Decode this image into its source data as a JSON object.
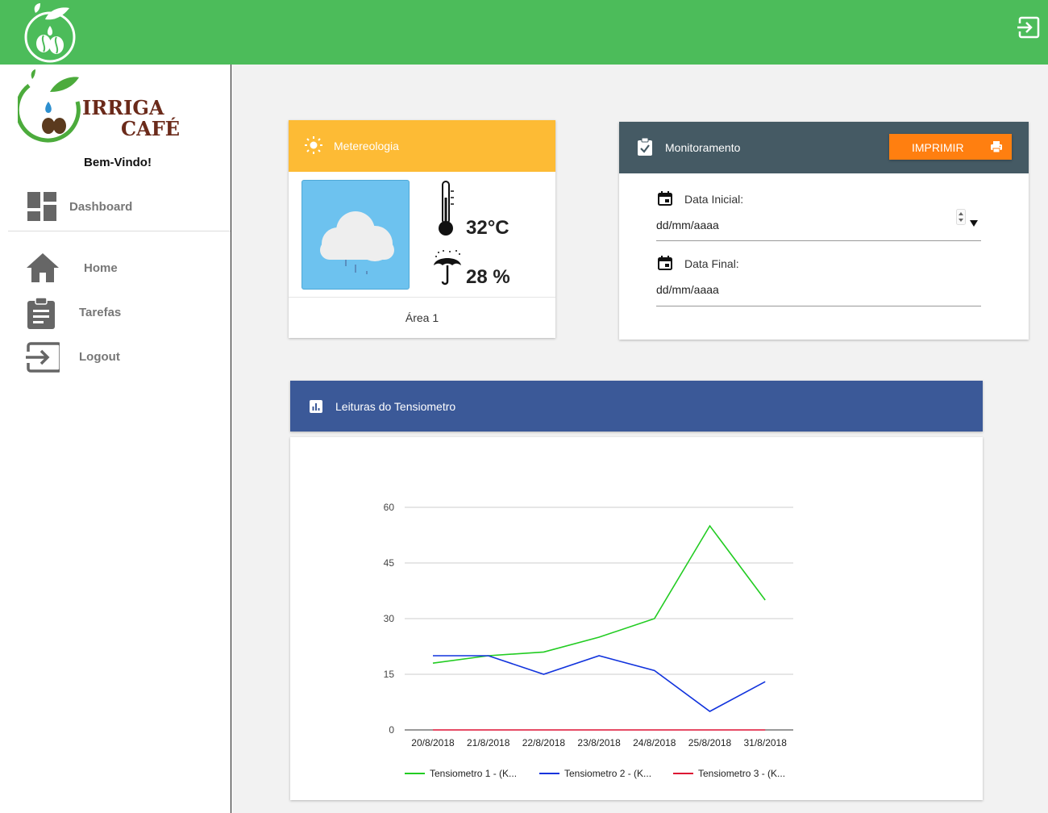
{
  "sidebar": {
    "welcome": "Bem-Vindo!",
    "logo_text": [
      "IRRIGA",
      "CAFÉ"
    ],
    "items": [
      {
        "label": "Dashboard",
        "icon": "dashboard-icon"
      },
      {
        "label": "Home",
        "icon": "home-icon"
      },
      {
        "label": "Tarefas",
        "icon": "clipboard-icon"
      },
      {
        "label": "Logout",
        "icon": "logout-icon"
      }
    ]
  },
  "weather": {
    "title": "Metereologia",
    "temperature": "32°C",
    "humidity": "28 %",
    "area": "Área 1",
    "header_color": "#fdbb35"
  },
  "monitoring": {
    "title": "Monitoramento",
    "print_label": "IMPRIMIR",
    "start_label": "Data Inicial:",
    "start_value": "dd/mm/aaaa",
    "end_label": "Data Final:",
    "end_value": "dd/mm/aaaa",
    "header_color": "#455a64",
    "button_color": "#ff7f10"
  },
  "chart_panel": {
    "title": "Leituras do Tensiometro",
    "header_color": "#3b5998"
  },
  "chart_data": {
    "type": "line",
    "categories": [
      "20/8/2018",
      "21/8/2018",
      "22/8/2018",
      "23/8/2018",
      "24/8/2018",
      "25/8/2018",
      "31/8/2018"
    ],
    "series": [
      {
        "name": "Tensiometro 1 - (K...",
        "color": "#22cc22",
        "values": [
          18,
          20,
          21,
          25,
          30,
          55,
          35
        ]
      },
      {
        "name": "Tensiometro 2 - (K...",
        "color": "#1133dd",
        "values": [
          20,
          20,
          15,
          20,
          16,
          5,
          13
        ]
      },
      {
        "name": "Tensiometro 3 - (K...",
        "color": "#dd1133",
        "values": [
          0,
          0,
          0,
          0,
          0,
          0,
          0
        ]
      }
    ],
    "yticks": [
      0,
      15,
      30,
      45,
      60
    ],
    "ylim": [
      0,
      60
    ],
    "grid": true,
    "legend_position": "bottom"
  }
}
